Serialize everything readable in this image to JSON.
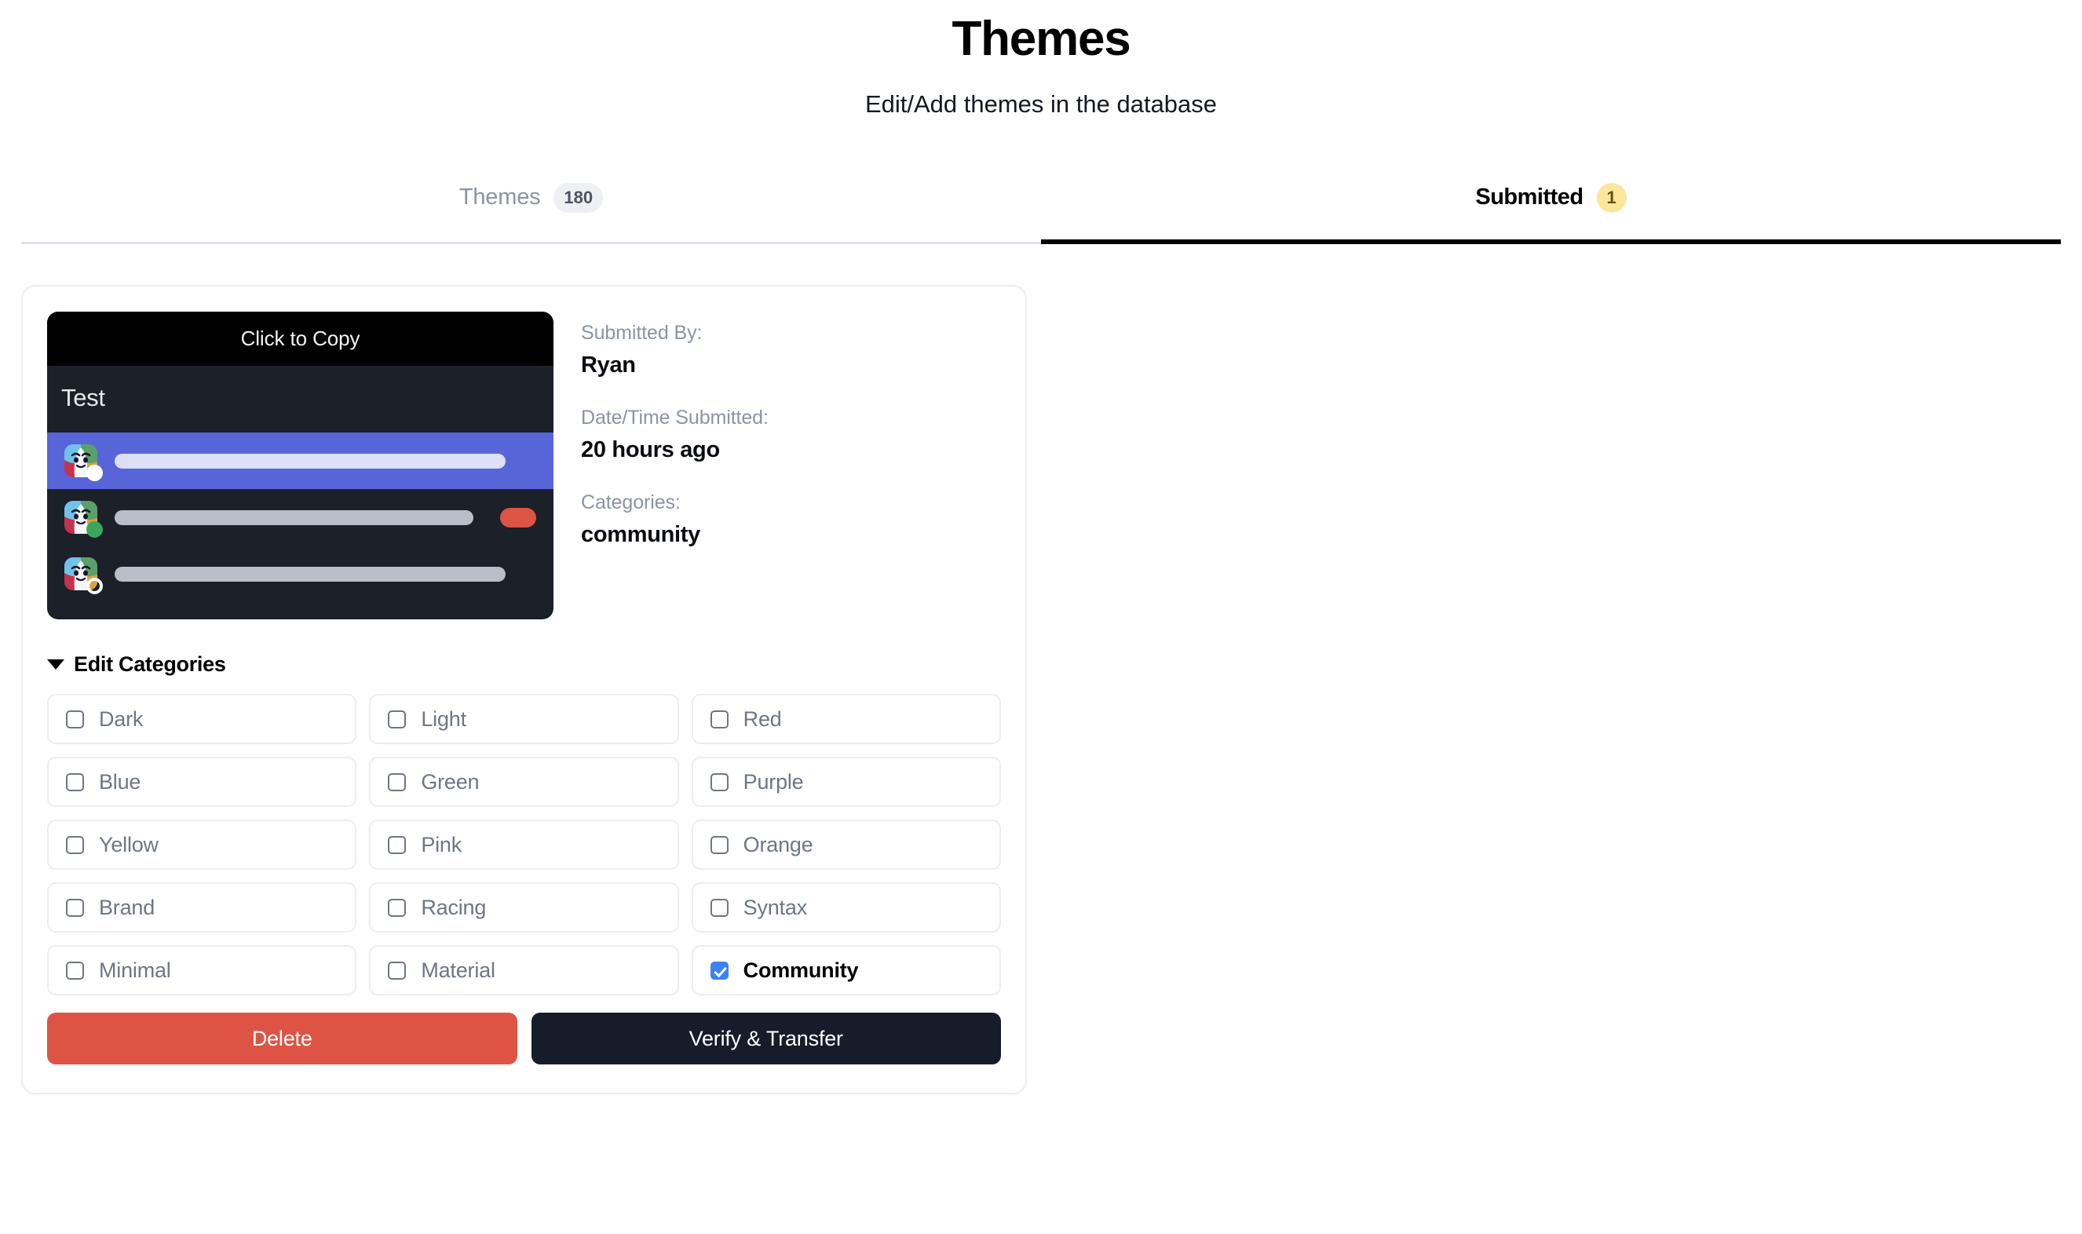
{
  "header": {
    "title": "Themes",
    "subtitle": "Edit/Add themes in the database"
  },
  "tabs": [
    {
      "label": "Themes",
      "badge": "180",
      "active": false
    },
    {
      "label": "Submitted",
      "badge": "1",
      "active": true
    }
  ],
  "submission": {
    "preview": {
      "copy_label": "Click to Copy",
      "theme_name": "Test",
      "rows": [
        {
          "status": "white",
          "highlight": true,
          "pill": false
        },
        {
          "status": "online",
          "highlight": false,
          "pill": true
        },
        {
          "status": "ring",
          "highlight": false,
          "pill": false
        }
      ]
    },
    "meta": [
      {
        "label": "Submitted By:",
        "value": "Ryan"
      },
      {
        "label": "Date/Time Submitted:",
        "value": "20 hours ago"
      },
      {
        "label": "Categories:",
        "value": "community"
      }
    ],
    "edit_categories": {
      "title": "Edit Categories",
      "caret": "caret-down-icon",
      "items": [
        {
          "label": "Dark",
          "checked": false
        },
        {
          "label": "Light",
          "checked": false
        },
        {
          "label": "Red",
          "checked": false
        },
        {
          "label": "Blue",
          "checked": false
        },
        {
          "label": "Green",
          "checked": false
        },
        {
          "label": "Purple",
          "checked": false
        },
        {
          "label": "Yellow",
          "checked": false
        },
        {
          "label": "Pink",
          "checked": false
        },
        {
          "label": "Orange",
          "checked": false
        },
        {
          "label": "Brand",
          "checked": false
        },
        {
          "label": "Racing",
          "checked": false
        },
        {
          "label": "Syntax",
          "checked": false
        },
        {
          "label": "Minimal",
          "checked": false
        },
        {
          "label": "Material",
          "checked": false
        },
        {
          "label": "Community",
          "checked": true
        }
      ]
    },
    "actions": {
      "delete_label": "Delete",
      "verify_label": "Verify & Transfer"
    }
  },
  "colors": {
    "accent_blue": "#3b82f6",
    "danger_red": "#dd5444",
    "dark_navy": "#161c29",
    "badge_active": "#fbe79c",
    "badge_inactive": "#eef0f3",
    "preview_highlight": "#5865d9",
    "preview_bg": "#1c2028",
    "status_online": "#3ba55c"
  }
}
